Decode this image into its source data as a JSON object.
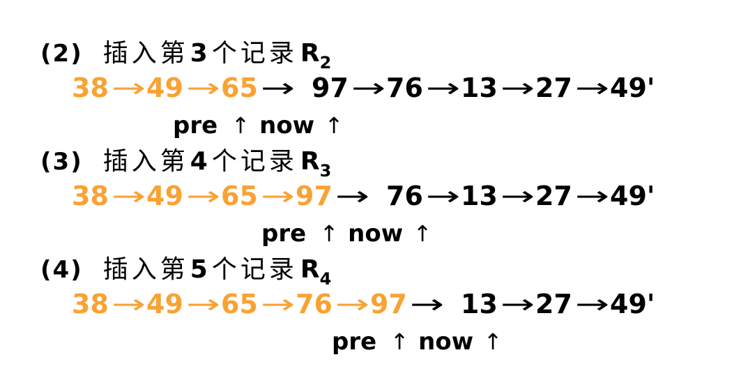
{
  "colors": {
    "sorted": "#F9A233",
    "text": "#000000",
    "background": "#FFFFFF"
  },
  "symbols": {
    "arrow_icon": "right-arrow",
    "arrow": "→",
    "pointer_icon": "up-arrow",
    "up_arrow": "↑"
  },
  "steps": [
    {
      "label": "(2)",
      "title_before": "插入第",
      "ordinal": "3",
      "title_after": "个记录",
      "record": "R",
      "record_sub": "2",
      "sorted": [
        "38",
        "49",
        "65"
      ],
      "unsorted": [
        "97",
        "76",
        "13",
        "27",
        "49'"
      ],
      "pointers": {
        "pre": "pre",
        "now": "now"
      }
    },
    {
      "label": "(3)",
      "title_before": "插入第",
      "ordinal": "4",
      "title_after": "个记录",
      "record": "R",
      "record_sub": "3",
      "sorted": [
        "38",
        "49",
        "65",
        "97"
      ],
      "unsorted": [
        "76",
        "13",
        "27",
        "49'"
      ],
      "pointers": {
        "pre": "pre",
        "now": "now"
      }
    },
    {
      "label": "(4)",
      "title_before": "插入第",
      "ordinal": "5",
      "title_after": "个记录",
      "record": "R",
      "record_sub": "4",
      "sorted": [
        "38",
        "49",
        "65",
        "76",
        "97"
      ],
      "unsorted": [
        "13",
        "27",
        "49'"
      ],
      "pointers": {
        "pre": "pre",
        "now": "now"
      }
    }
  ]
}
